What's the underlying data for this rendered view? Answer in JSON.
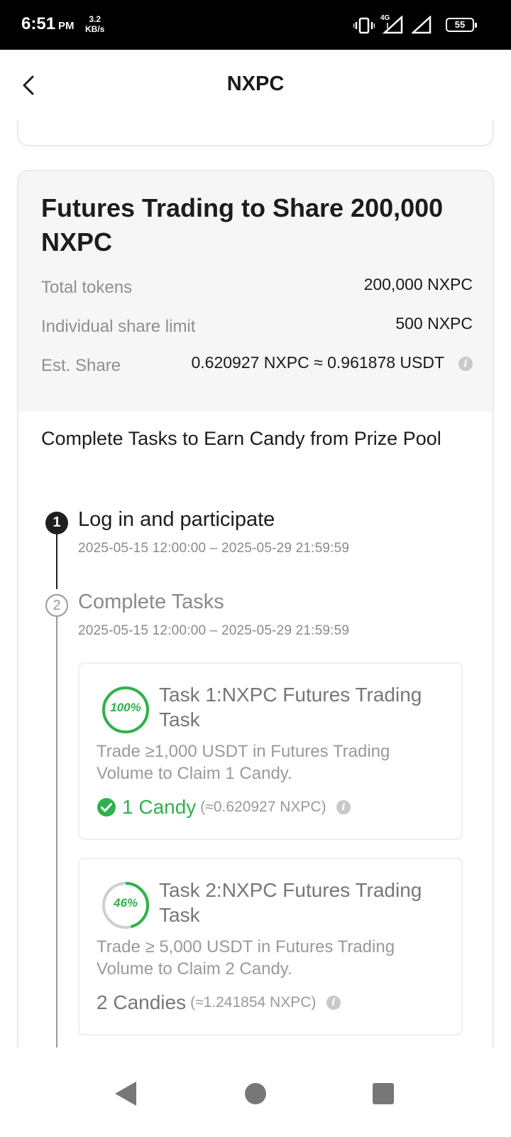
{
  "status_bar": {
    "time": "6:51",
    "ampm": "PM",
    "speed_value": "3.2",
    "speed_unit": "KB/s",
    "network_label": "4G",
    "battery": "55"
  },
  "header": {
    "title": "NXPC"
  },
  "campaign": {
    "title": "Futures Trading to Share 200,000 NXPC",
    "stats": [
      {
        "label": "Total tokens",
        "value": "200,000 NXPC"
      },
      {
        "label": "Individual share limit",
        "value": "500 NXPC"
      },
      {
        "label": "Est. Share",
        "value": "0.620927 NXPC ≈ 0.961878 USDT"
      }
    ]
  },
  "tasks_section": {
    "title": "Complete Tasks to Earn Candy from Prize Pool",
    "steps": [
      {
        "number": "1",
        "title": "Log in and participate",
        "date": "2025-05-15 12:00:00 – 2025-05-29 21:59:59"
      },
      {
        "number": "2",
        "title": "Complete Tasks",
        "date": "2025-05-15 12:00:00 – 2025-05-29 21:59:59"
      }
    ],
    "tasks": [
      {
        "progress_label": "100%",
        "progress_fraction": 1.0,
        "title": "Task 1:NXPC Futures Trading Task",
        "description": "Trade ≥1,000 USDT in Futures Trading Volume to Claim 1 Candy.",
        "reward": "1 Candy",
        "reward_equiv": "(≈0.620927 NXPC)",
        "completed": true
      },
      {
        "progress_label": "46%",
        "progress_fraction": 0.46,
        "title": "Task 2:NXPC Futures Trading Task",
        "description": "Trade ≥ 5,000 USDT in Futures Trading Volume to Claim 2 Candy.",
        "reward": "2 Candies",
        "reward_equiv": "(≈1.241854 NXPC)",
        "completed": false
      }
    ]
  },
  "colors": {
    "accent_green": "#2fb24a",
    "step_active": "#1f1f1f",
    "step_inactive": "#9a9a9a"
  },
  "icons": {
    "back": "chevron-left-icon",
    "info": "info-icon",
    "check": "check-circle-icon",
    "nav_back": "triangle-back-icon",
    "nav_home": "circle-home-icon",
    "nav_recents": "square-recents-icon"
  }
}
